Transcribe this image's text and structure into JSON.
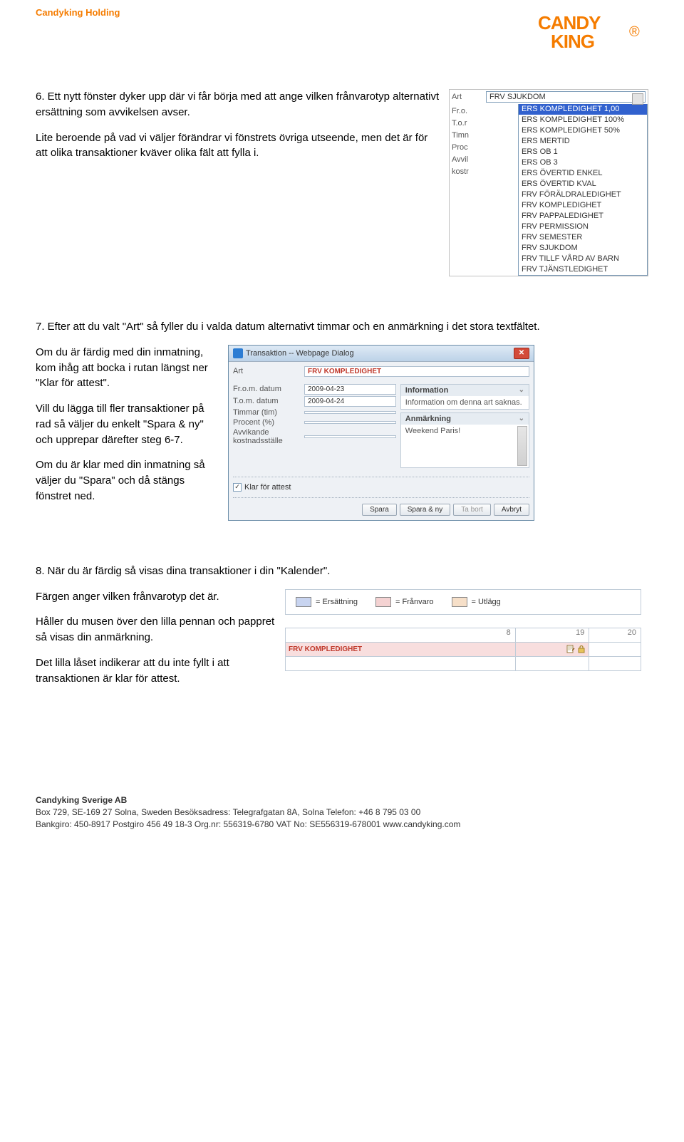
{
  "header": {
    "title": "Candyking Holding"
  },
  "logo": {
    "line1": "CANDY",
    "line2": "KING"
  },
  "step6": {
    "p1": "6. Ett nytt fönster dyker upp där vi får börja med att ange vilken frånvarotyp alternativt ersättning som avvikelsen avser.",
    "p2": "Lite beroende på vad vi väljer förändrar vi fönstrets övriga utseende, men det är för att olika transaktioner kväver olika fält att fylla i."
  },
  "dropdown_fig": {
    "art_label": "Art",
    "selected": "FRV SJUKDOM",
    "side_labels": [
      "Fr.o.",
      "T.o.r",
      "Timn",
      "Proc",
      "Avvil",
      "kostr"
    ],
    "options": [
      "ERS KOMPLEDIGHET 1,00",
      "ERS KOMPLEDIGHET 100%",
      "ERS KOMPLEDIGHET 50%",
      "ERS MERTID",
      "ERS OB 1",
      "ERS OB 3",
      "ERS ÖVERTID ENKEL",
      "ERS ÖVERTID KVAL",
      "FRV FÖRÄLDRALEDIGHET",
      "FRV KOMPLEDIGHET",
      "FRV PAPPALEDIGHET",
      "FRV PERMISSION",
      "FRV SEMESTER",
      "FRV SJUKDOM",
      "FRV TILLF VÅRD AV BARN",
      "FRV TJÄNSTLEDIGHET"
    ]
  },
  "step7": {
    "p1": "7. Efter att du valt \"Art\" så fyller du i valda datum alternativt timmar och en anmärkning i det stora textfältet.",
    "p2": "Om du är färdig med din inmatning, kom ihåg att bocka i rutan längst ner \"Klar för attest\".",
    "p3": "Vill du lägga till fler transaktioner på rad så väljer du enkelt \"Spara & ny\" och upprepar därefter steg 6-7.",
    "p4": "Om du är klar med din inmatning så väljer du \"Spara\" och då stängs fönstret ned."
  },
  "dialog": {
    "title": "Transaktion -- Webpage Dialog",
    "art_label": "Art",
    "art_value": "FRV KOMPLEDIGHET",
    "fields": {
      "from_label": "Fr.o.m. datum",
      "from_value": "2009-04-23",
      "to_label": "T.o.m. datum",
      "to_value": "2009-04-24",
      "tim_label": "Timmar (tim)",
      "tim_value": "",
      "pct_label": "Procent (%)",
      "pct_value": "",
      "avv_label": "Avvikande kostnadsställe",
      "avv_value": ""
    },
    "info_panel": {
      "title": "Information",
      "text": "Information om denna art saknas."
    },
    "note_panel": {
      "title": "Anmärkning",
      "text": "Weekend Paris!"
    },
    "checkbox_label": "Klar för attest",
    "buttons": {
      "save": "Spara",
      "save_new": "Spara & ny",
      "delete": "Ta bort",
      "cancel": "Avbryt"
    }
  },
  "step8": {
    "p1": "8. När du är färdig så visas dina transaktioner i din \"Kalender\".",
    "p2": "Färgen anger vilken frånvarotyp det är.",
    "p3": "Håller du musen över den lilla pennan och pappret så visas din anmärkning.",
    "p4": "Det lilla låset indikerar att du inte fyllt i att transaktionen är klar för attest."
  },
  "calendar": {
    "legend": [
      {
        "label": "= Ersättning",
        "color": "#c8d4f0"
      },
      {
        "label": "= Frånvaro",
        "color": "#f4d2d2"
      },
      {
        "label": "= Utlägg",
        "color": "#f6dfc8"
      }
    ],
    "days": [
      "8",
      "19",
      "20"
    ],
    "entry_label": "FRV KOMPLEDIGHET"
  },
  "footer": {
    "company": "Candyking Sverige AB",
    "line1": "Box 729, SE-169 27 Solna, Sweden   Besöksadress: Telegrafgatan 8A, Solna   Telefon: +46 8 795 03 00",
    "line2": "Bankgiro: 450-8917  Postgiro 456 49 18-3  Org.nr: 556319-6780  VAT No: SE556319-678001  www.candyking.com"
  }
}
